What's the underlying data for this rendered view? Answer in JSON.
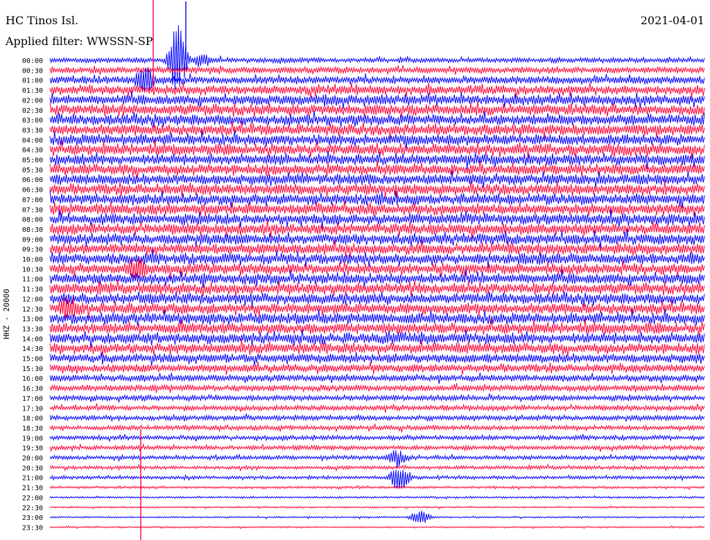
{
  "header": {
    "station": "HC Tinos Isl.",
    "date": "2021-04-01",
    "filter": "Applied filter: WWSSN-SP"
  },
  "channel_label": "HHZ - 20000",
  "chart_data": {
    "type": "line",
    "chart_kind": "helicorder",
    "title": "HC Tinos Isl.",
    "date": "2021-04-01",
    "filter": "WWSSN-SP",
    "ylabel": "HHZ - 20000",
    "row_duration_minutes": 30,
    "rows": [
      "00:00",
      "00:30",
      "01:00",
      "01:30",
      "02:00",
      "02:30",
      "03:00",
      "03:30",
      "04:00",
      "04:30",
      "05:00",
      "05:30",
      "06:00",
      "06:30",
      "07:00",
      "07:30",
      "08:00",
      "08:30",
      "09:00",
      "09:30",
      "10:00",
      "10:30",
      "11:00",
      "11:30",
      "12:00",
      "12:30",
      "13:00",
      "13:30",
      "14:00",
      "14:30",
      "15:00",
      "15:30",
      "16:00",
      "16:30",
      "17:00",
      "17:30",
      "18:00",
      "18:30",
      "19:00",
      "19:30",
      "20:00",
      "20:30",
      "21:00",
      "21:30",
      "22:00",
      "22:30",
      "23:00",
      "23:30"
    ],
    "trace_colors": [
      "#0000ff",
      "#ff0033"
    ],
    "relative_amplitude": [
      0.45,
      0.55,
      0.7,
      0.85,
      0.95,
      1.0,
      1.0,
      1.0,
      1.0,
      1.0,
      1.0,
      1.0,
      1.0,
      1.0,
      1.0,
      1.0,
      1.0,
      1.0,
      1.0,
      1.0,
      1.0,
      1.0,
      1.0,
      1.0,
      1.0,
      1.0,
      1.0,
      1.0,
      1.0,
      0.95,
      0.85,
      0.75,
      0.6,
      0.55,
      0.5,
      0.45,
      0.45,
      0.42,
      0.4,
      0.4,
      0.38,
      0.32,
      0.3,
      0.22,
      0.18,
      0.15,
      0.15,
      0.14
    ],
    "events": [
      {
        "row": "00:00",
        "fraction": 0.195,
        "amplitude": 6.0
      },
      {
        "row": "00:00",
        "fraction": 0.23,
        "amplitude": 1.2
      },
      {
        "row": "01:00",
        "fraction": 0.145,
        "amplitude": 2.2
      },
      {
        "row": "10:30",
        "fraction": 0.135,
        "amplitude": 2.0
      },
      {
        "row": "12:30",
        "fraction": 0.03,
        "amplitude": 1.5
      },
      {
        "row": "20:00",
        "fraction": 0.53,
        "amplitude": 1.4
      },
      {
        "row": "21:00",
        "fraction": 0.535,
        "amplitude": 2.4
      },
      {
        "row": "23:00",
        "fraction": 0.565,
        "amplitude": 1.3
      }
    ]
  }
}
